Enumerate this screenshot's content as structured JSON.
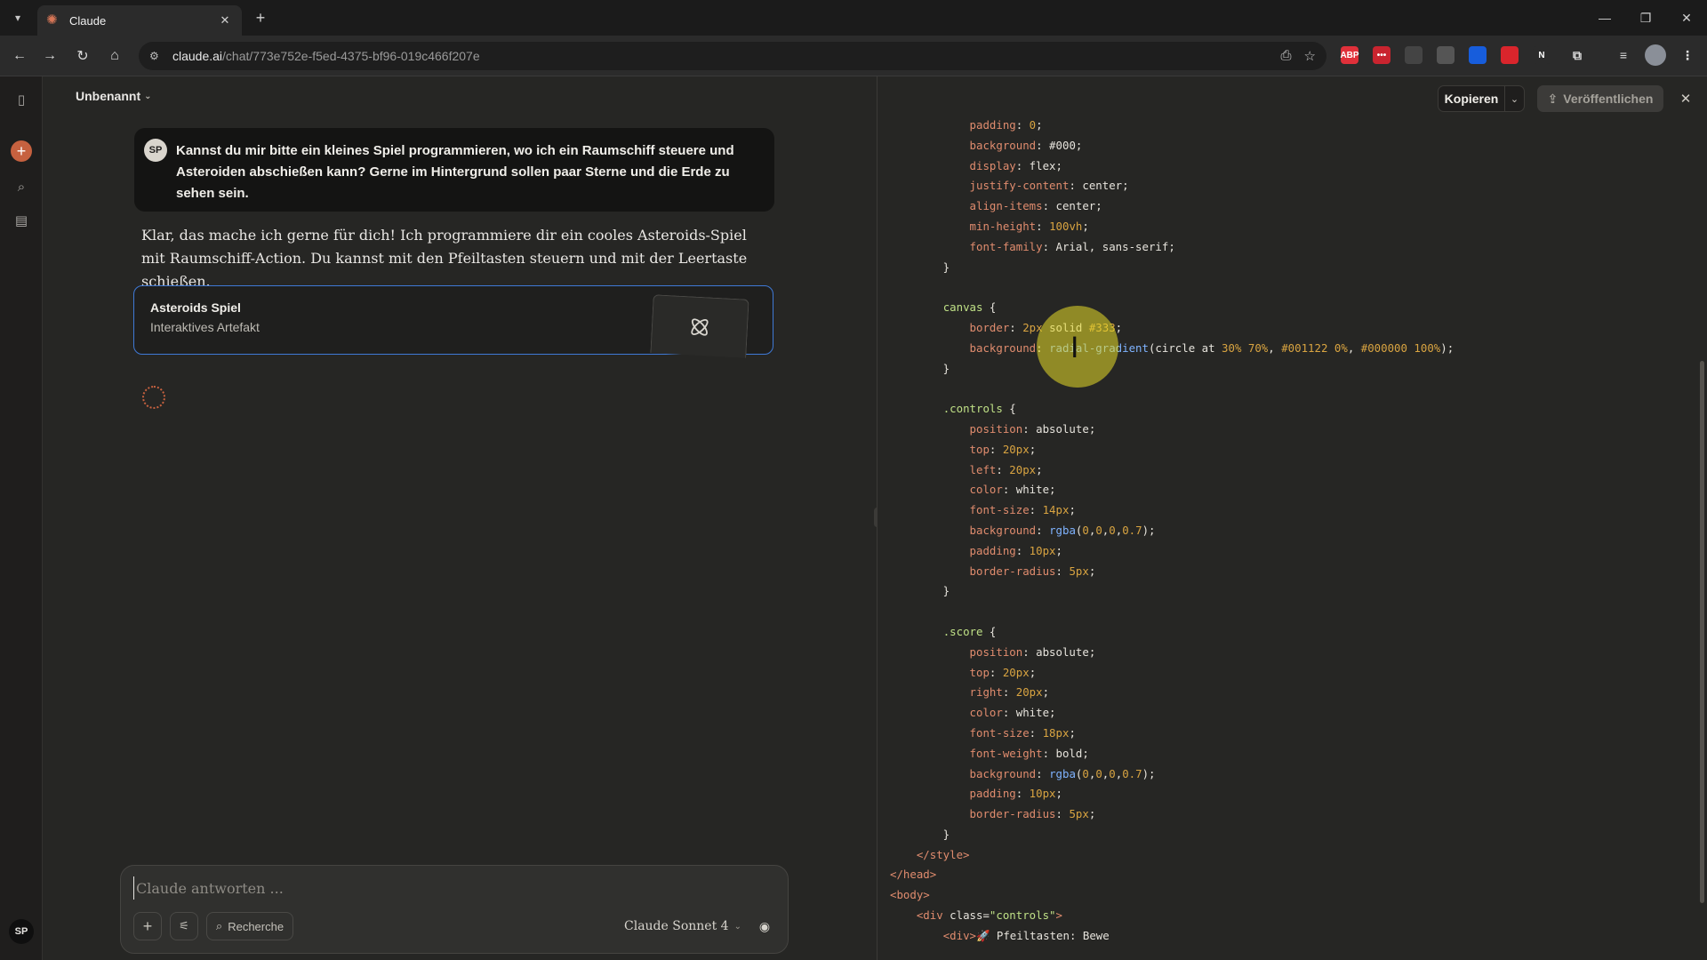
{
  "browser": {
    "tab_title": "Claude",
    "url_host": "claude.ai",
    "url_path": "/chat/773e752e-f5ed-4375-bf96-019c466f207e",
    "extensions": [
      {
        "icon": "adblock-icon",
        "label": "ABP",
        "color": "#e0303a"
      },
      {
        "icon": "lastpass-icon",
        "label": "•••",
        "color": "#c9242f"
      },
      {
        "icon": "rainbow-icon",
        "label": "",
        "color": "#444444"
      },
      {
        "icon": "camera-icon",
        "label": "",
        "color": "#555555"
      },
      {
        "icon": "bitwarden-icon",
        "label": "",
        "color": "#175ddc"
      },
      {
        "icon": "flash-icon",
        "label": "",
        "color": "#d9252c"
      },
      {
        "icon": "notion-icon",
        "label": "N",
        "color": "#2b2b2b"
      }
    ]
  },
  "app": {
    "accent": "#c6613f",
    "rail_avatar": "SP"
  },
  "chat": {
    "title": "Unbenannt",
    "user_avatar": "SP",
    "user_message": "Kannst du mir bitte ein kleines Spiel programmieren, wo ich ein Raumschiff steuere und Asteroiden abschießen kann? Gerne im Hintergrund sollen paar Sterne und die Erde zu sehen sein.",
    "assistant_message": "Klar, das mache ich gerne für dich! Ich programmiere dir ein cooles Asteroids-Spiel mit Raumschiff-Action. Du kannst mit den Pfeiltasten steuern und mit der Leertaste schießen.",
    "artifact": {
      "title": "Asteroids Spiel",
      "subtitle": "Interaktives Artefakt"
    },
    "composer": {
      "placeholder": "Claude antworten ...",
      "research_label": "Recherche",
      "model": "Claude Sonnet 4"
    }
  },
  "panel": {
    "copy_label": "Kopieren",
    "publish_label": "Veröffentlichen",
    "code_lines": [
      [
        [
          "            ",
          ""
        ],
        [
          "padding",
          "p"
        ],
        [
          ": ",
          ""
        ],
        [
          "0",
          "n"
        ],
        [
          ";",
          ""
        ]
      ],
      [
        [
          "            ",
          ""
        ],
        [
          "background",
          "p"
        ],
        [
          ": #000;",
          ""
        ]
      ],
      [
        [
          "            ",
          ""
        ],
        [
          "display",
          "p"
        ],
        [
          ": flex;",
          ""
        ]
      ],
      [
        [
          "            ",
          ""
        ],
        [
          "justify-content",
          "p"
        ],
        [
          ": center;",
          ""
        ]
      ],
      [
        [
          "            ",
          ""
        ],
        [
          "align-items",
          "p"
        ],
        [
          ": center;",
          ""
        ]
      ],
      [
        [
          "            ",
          ""
        ],
        [
          "min-height",
          "p"
        ],
        [
          ": ",
          ""
        ],
        [
          "100vh",
          "n"
        ],
        [
          ";",
          ""
        ]
      ],
      [
        [
          "            ",
          ""
        ],
        [
          "font-family",
          "p"
        ],
        [
          ": Arial, sans-serif;",
          ""
        ]
      ],
      [
        [
          "        }",
          ""
        ]
      ],
      [
        [
          "",
          ""
        ]
      ],
      [
        [
          "        ",
          ""
        ],
        [
          "canvas",
          "s"
        ],
        [
          " {",
          ""
        ]
      ],
      [
        [
          "            ",
          ""
        ],
        [
          "border",
          "p"
        ],
        [
          ": ",
          ""
        ],
        [
          "2px",
          "n"
        ],
        [
          " solid ",
          ""
        ],
        [
          "#333",
          "n"
        ],
        [
          ";",
          ""
        ]
      ],
      [
        [
          "            ",
          ""
        ],
        [
          "background",
          "p"
        ],
        [
          ": ",
          ""
        ],
        [
          "radial-gradient",
          "f"
        ],
        [
          "(circle at ",
          ""
        ],
        [
          "30%",
          "n"
        ],
        [
          " ",
          ""
        ],
        [
          "70%",
          "n"
        ],
        [
          ", ",
          ""
        ],
        [
          "#001122",
          "n"
        ],
        [
          " ",
          ""
        ],
        [
          "0%",
          "n"
        ],
        [
          ", ",
          ""
        ],
        [
          "#000000",
          "n"
        ],
        [
          " ",
          ""
        ],
        [
          "100%",
          "n"
        ],
        [
          ");",
          ""
        ]
      ],
      [
        [
          "        }",
          ""
        ]
      ],
      [
        [
          "",
          ""
        ]
      ],
      [
        [
          "        ",
          ""
        ],
        [
          ".controls",
          "s"
        ],
        [
          " {",
          ""
        ]
      ],
      [
        [
          "            ",
          ""
        ],
        [
          "position",
          "p"
        ],
        [
          ": absolute;",
          ""
        ]
      ],
      [
        [
          "            ",
          ""
        ],
        [
          "top",
          "p"
        ],
        [
          ": ",
          ""
        ],
        [
          "20px",
          "n"
        ],
        [
          ";",
          ""
        ]
      ],
      [
        [
          "            ",
          ""
        ],
        [
          "left",
          "p"
        ],
        [
          ": ",
          ""
        ],
        [
          "20px",
          "n"
        ],
        [
          ";",
          ""
        ]
      ],
      [
        [
          "            ",
          ""
        ],
        [
          "color",
          "p"
        ],
        [
          ": white;",
          ""
        ]
      ],
      [
        [
          "            ",
          ""
        ],
        [
          "font-size",
          "p"
        ],
        [
          ": ",
          ""
        ],
        [
          "14px",
          "n"
        ],
        [
          ";",
          ""
        ]
      ],
      [
        [
          "            ",
          ""
        ],
        [
          "background",
          "p"
        ],
        [
          ": ",
          ""
        ],
        [
          "rgba",
          "f"
        ],
        [
          "(",
          ""
        ],
        [
          "0",
          "n"
        ],
        [
          ",",
          ""
        ],
        [
          "0",
          "n"
        ],
        [
          ",",
          ""
        ],
        [
          "0",
          "n"
        ],
        [
          ",",
          ""
        ],
        [
          "0.7",
          "n"
        ],
        [
          ");",
          ""
        ]
      ],
      [
        [
          "            ",
          ""
        ],
        [
          "padding",
          "p"
        ],
        [
          ": ",
          ""
        ],
        [
          "10px",
          "n"
        ],
        [
          ";",
          ""
        ]
      ],
      [
        [
          "            ",
          ""
        ],
        [
          "border-radius",
          "p"
        ],
        [
          ": ",
          ""
        ],
        [
          "5px",
          "n"
        ],
        [
          ";",
          ""
        ]
      ],
      [
        [
          "        }",
          ""
        ]
      ],
      [
        [
          "",
          ""
        ]
      ],
      [
        [
          "        ",
          ""
        ],
        [
          ".score",
          "s"
        ],
        [
          " {",
          ""
        ]
      ],
      [
        [
          "            ",
          ""
        ],
        [
          "position",
          "p"
        ],
        [
          ": absolute;",
          ""
        ]
      ],
      [
        [
          "            ",
          ""
        ],
        [
          "top",
          "p"
        ],
        [
          ": ",
          ""
        ],
        [
          "20px",
          "n"
        ],
        [
          ";",
          ""
        ]
      ],
      [
        [
          "            ",
          ""
        ],
        [
          "right",
          "p"
        ],
        [
          ": ",
          ""
        ],
        [
          "20px",
          "n"
        ],
        [
          ";",
          ""
        ]
      ],
      [
        [
          "            ",
          ""
        ],
        [
          "color",
          "p"
        ],
        [
          ": white;",
          ""
        ]
      ],
      [
        [
          "            ",
          ""
        ],
        [
          "font-size",
          "p"
        ],
        [
          ": ",
          ""
        ],
        [
          "18px",
          "n"
        ],
        [
          ";",
          ""
        ]
      ],
      [
        [
          "            ",
          ""
        ],
        [
          "font-weight",
          "p"
        ],
        [
          ": bold;",
          ""
        ]
      ],
      [
        [
          "            ",
          ""
        ],
        [
          "background",
          "p"
        ],
        [
          ": ",
          ""
        ],
        [
          "rgba",
          "f"
        ],
        [
          "(",
          ""
        ],
        [
          "0",
          "n"
        ],
        [
          ",",
          ""
        ],
        [
          "0",
          "n"
        ],
        [
          ",",
          ""
        ],
        [
          "0",
          "n"
        ],
        [
          ",",
          ""
        ],
        [
          "0.7",
          "n"
        ],
        [
          ");",
          ""
        ]
      ],
      [
        [
          "            ",
          ""
        ],
        [
          "padding",
          "p"
        ],
        [
          ": ",
          ""
        ],
        [
          "10px",
          "n"
        ],
        [
          ";",
          ""
        ]
      ],
      [
        [
          "            ",
          ""
        ],
        [
          "border-radius",
          "p"
        ],
        [
          ": ",
          ""
        ],
        [
          "5px",
          "n"
        ],
        [
          ";",
          ""
        ]
      ],
      [
        [
          "        }",
          ""
        ]
      ],
      [
        [
          "    ",
          ""
        ],
        [
          "</style>",
          "t"
        ]
      ],
      [
        [
          "",
          ""
        ],
        [
          "</head>",
          "t"
        ]
      ],
      [
        [
          "",
          ""
        ],
        [
          "<body>",
          "t"
        ]
      ],
      [
        [
          "    ",
          ""
        ],
        [
          "<div",
          "t"
        ],
        [
          " class=",
          ""
        ],
        [
          "\"controls\"",
          "q"
        ],
        [
          ">",
          "t"
        ]
      ],
      [
        [
          "        ",
          ""
        ],
        [
          "<div>",
          "t"
        ],
        [
          "🚀 Pfeiltasten: Bewe",
          ""
        ]
      ]
    ]
  }
}
